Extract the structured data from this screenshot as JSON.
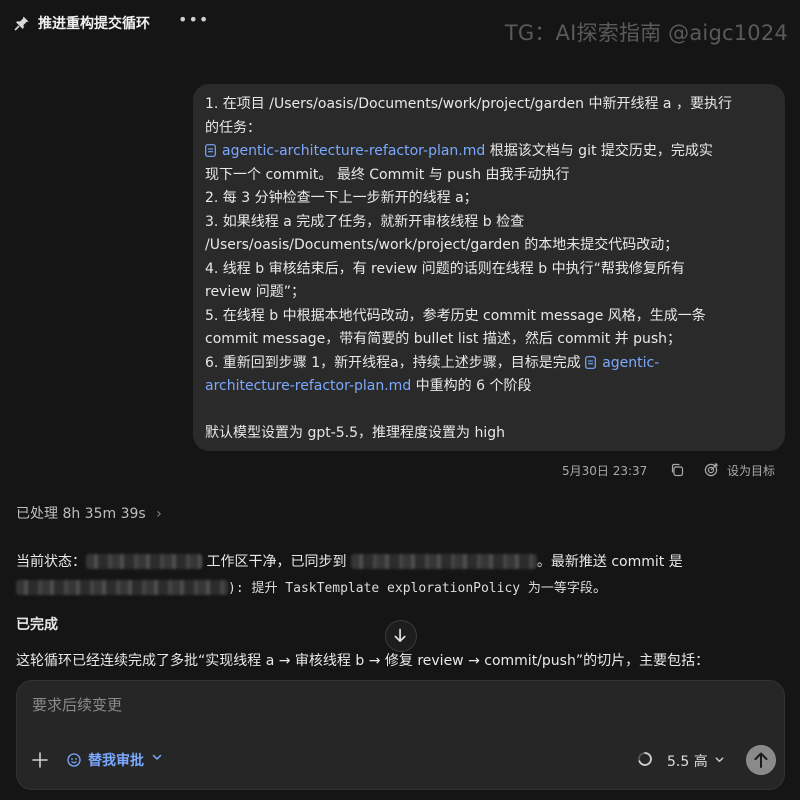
{
  "header": {
    "title": "推进重构提交循环",
    "more_icon": "•••",
    "watermark": "TG：AI探索指南 @aigc1024"
  },
  "message": {
    "lines": {
      "l1": "1. 在项目 /Users/oasis/Documents/work/project/garden  中新开线程 a ，要执行",
      "l2": "的任务：",
      "l3_file": "agentic-architecture-refactor-plan.md",
      "l3_rest": " 根据该文档与 git 提交历史，完成实",
      "l4": "现下一个 commit。 最终 Commit 与  push 由我手动执行",
      "l5": "2. 每 3 分钟检查一下上一步新开的线程 a；",
      "l6": "3. 如果线程 a 完成了任务，就新开审核线程 b  检查",
      "l7": "/Users/oasis/Documents/work/project/garden 的本地未提交代码改动；",
      "l8": "4. 线程 b 审核结束后，有 review 问题的话则在线程 b 中执行“帮我修复所有",
      "l9": "review 问题”；",
      "l10": "5. 在线程 b 中根据本地代码改动，参考历史 commit message 风格，生成一条",
      "l11": "commit message，带有简要的 bullet list 描述，然后 commit 并 push；",
      "l12_pre": "6. 重新回到步骤 1，新开线程a，持续上述步骤，目标是完成 ",
      "l12_file": "agentic-",
      "l13_file": "architecture-refactor-plan.md",
      "l13_rest": " 中重构的 6 个阶段",
      "l15": "默认模型设置为 gpt-5.5，推理程度设置为 high"
    },
    "timestamp": "5月30日 23:37",
    "set_goal": "设为目标"
  },
  "processed": {
    "label": "已处理",
    "duration": "8h 35m 39s",
    "chevron": "›"
  },
  "assistant": {
    "status_prefix": "当前状态：",
    "status_mid": " 工作区干净，已同步到 ",
    "status_tail": "。最新推送 commit 是",
    "commit_close": "):",
    "commit_msg": " 提升 TaskTemplate explorationPolicy 为一等字段",
    "commit_end": "。",
    "done_heading": "已完成",
    "summary": "这轮循环已经连续完成了多批“实现线程 a → 审核线程 b → 修复 review → commit/push”的切片，主要包括："
  },
  "composer": {
    "placeholder": "要求后续变更",
    "approve_label": "替我审批",
    "model_value": "5.5",
    "effort_value": "高"
  }
}
